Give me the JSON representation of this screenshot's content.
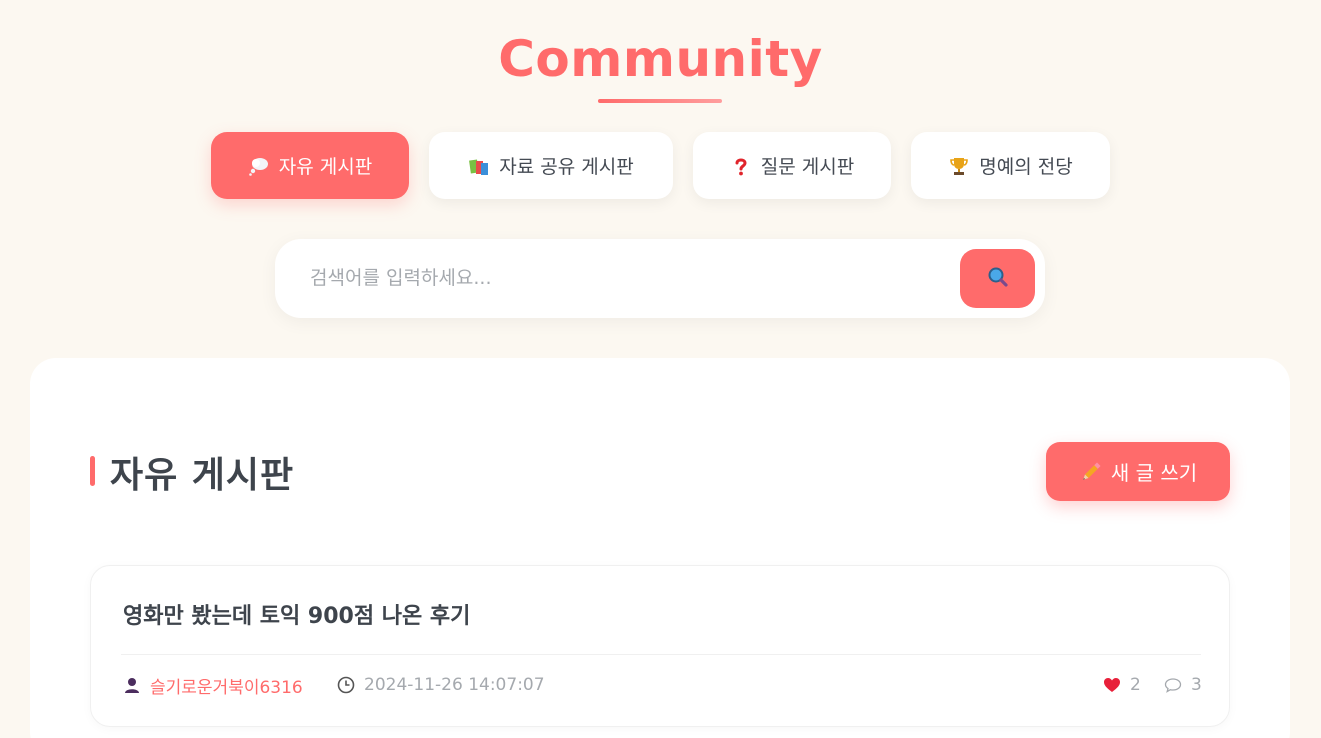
{
  "header": {
    "title": "Community"
  },
  "tabs": [
    {
      "label": "자유 게시판",
      "icon": "thought-bubble-icon",
      "active": true
    },
    {
      "label": "자료 공유 게시판",
      "icon": "books-icon",
      "active": false
    },
    {
      "label": "질문 게시판",
      "icon": "question-mark-icon",
      "active": false
    },
    {
      "label": "명예의 전당",
      "icon": "trophy-icon",
      "active": false
    }
  ],
  "search": {
    "placeholder": "검색어를 입력하세요...",
    "value": "",
    "button_icon": "magnifier-icon"
  },
  "board": {
    "title": "자유 게시판",
    "write_label": "새 글 쓰기",
    "posts": [
      {
        "title": "영화만 봤는데 토익 900점 나온 후기",
        "author": "슬기로운거북이6316",
        "date": "2024-11-26 14:07:07",
        "likes": "2",
        "comments": "3"
      }
    ]
  },
  "colors": {
    "accent": "#ff6b6b",
    "background": "#fcf8f1",
    "text": "#444a53",
    "muted": "#a5a9ae"
  }
}
